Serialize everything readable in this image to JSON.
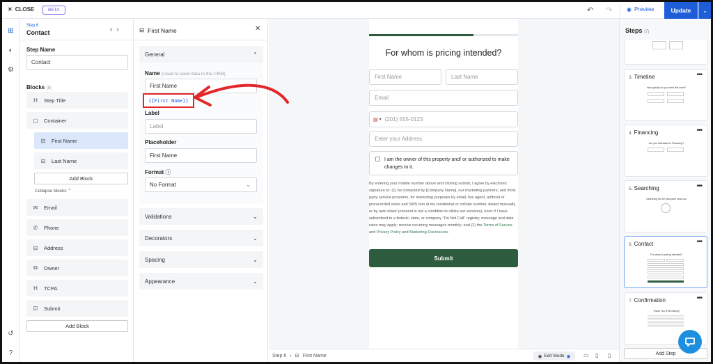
{
  "topbar": {
    "close_label": "CLOSE",
    "beta_label": "BETA",
    "preview_label": "Preview",
    "update_label": "Update"
  },
  "step": {
    "small_label": "Step 6",
    "title": "Contact",
    "step_name_label": "Step Name",
    "step_name_value": "Contact",
    "blocks_label": "Blocks",
    "blocks_count": "(8)",
    "collapse_label": "Collapse blocks",
    "add_block_inner": "Add Block",
    "add_block": "Add Block",
    "blocks": [
      {
        "label": "Step Title",
        "icon": "heading-icon"
      },
      {
        "label": "Container",
        "icon": "container-icon"
      },
      {
        "label": "First Name",
        "icon": "text-field-icon"
      },
      {
        "label": "Last Name",
        "icon": "text-field-icon"
      },
      {
        "label": "Email",
        "icon": "mail-icon"
      },
      {
        "label": "Phone",
        "icon": "phone-icon"
      },
      {
        "label": "Address",
        "icon": "address-icon"
      },
      {
        "label": "Owner",
        "icon": "owner-icon"
      },
      {
        "label": "TCPA",
        "icon": "heading-icon"
      },
      {
        "label": "Submit",
        "icon": "checkbox-icon"
      }
    ]
  },
  "field": {
    "title": "First Name",
    "general_label": "General",
    "name_label": "Name",
    "name_hint": "(Used to send data to the CRM)",
    "name_value": "First Name",
    "merge_tag": "{{First Name}}",
    "label_label": "Label",
    "label_placeholder": "Label",
    "placeholder_label": "Placeholder",
    "placeholder_value": "First Name",
    "format_label": "Format",
    "format_value": "No Format",
    "sections": [
      "Validations",
      "Decorators",
      "Spacing",
      "Appearance"
    ]
  },
  "form": {
    "title": "For whom is pricing intended?",
    "progress": 0.7,
    "first_name_ph": "First Name",
    "last_name_ph": "Last Name",
    "email_ph": "Email",
    "phone_ph": "(201) 555-0123",
    "address_ph": "Enter your Address",
    "consent_text": "I am the owner of this property and/ or authorized to make changes to it.",
    "legal_text": "By entering your mobile number above and clicking submit, I agree by electronic signature to: (1) be contacted by [Company Name], our marketing partners, and third-party service providers, for marketing purposes by email, live agent, artificial or prerecorded voice and SMS text at my residential or cellular number, dialed manually or by auto dialer (consent is not a condition to utilize our services), even if I have subscribed to a federal, state, or company \"Do Not Call\" registry; message and data rates may apply; receive recurring messages monthly; and (2) the",
    "legal_link1": "Terms of Service",
    "legal_and": "and",
    "legal_link2": "Privacy Policy",
    "legal_and2": "and",
    "legal_link3": "Marketing Disclosures",
    "legal_end": ".",
    "submit_label": "Submit"
  },
  "bottombar": {
    "step_crumb": "Step 6",
    "field_crumb": "First Name",
    "edit_mode_label": "Edit Mode"
  },
  "steps_panel": {
    "title": "Steps",
    "count": "(7)",
    "add_step_label": "Add Step",
    "cards": [
      {
        "num": "3.",
        "name": "Timeline",
        "mini_title": "How quickly do you need this done?"
      },
      {
        "num": "4.",
        "name": "Financing",
        "mini_title": "Are you Interested in Financing?"
      },
      {
        "num": "5.",
        "name": "Searching",
        "mini_title": "Searching for the best price near you"
      },
      {
        "num": "6.",
        "name": "Contact",
        "mini_title": "For whom is pricing intended?"
      },
      {
        "num": "7.",
        "name": "Confirmation",
        "mini_title": "Thank You [First Name]!"
      }
    ]
  },
  "colors": {
    "accent": "#1d5ed8",
    "submit_green": "#2d5c3e",
    "annotation_red": "#e3262a"
  }
}
